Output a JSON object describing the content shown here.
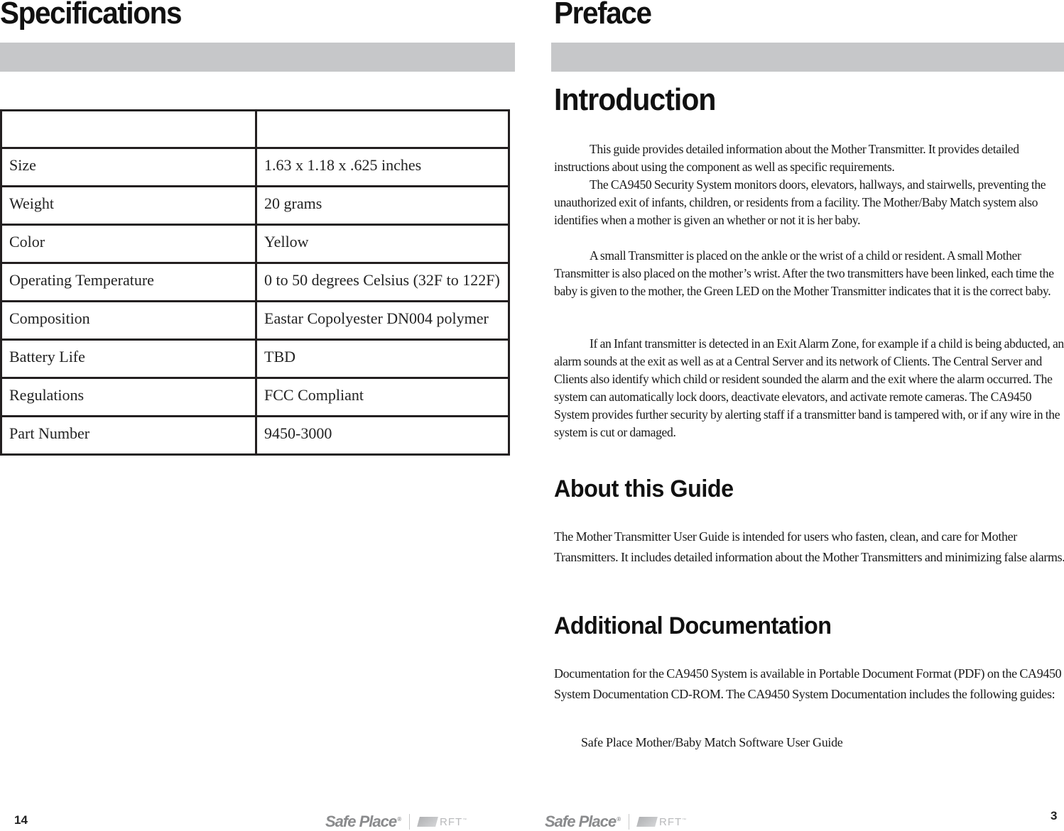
{
  "left_page": {
    "title": "Specifications",
    "table": {
      "header": [
        "",
        ""
      ],
      "rows": [
        {
          "label": "Size",
          "value": "1.63 x 1.18 x .625 inches"
        },
        {
          "label": "Weight",
          "value": "20 grams"
        },
        {
          "label": "Color",
          "value": "Yellow"
        },
        {
          "label": "Operating Temperature",
          "value": "0 to 50 degrees Celsius (32F to 122F)"
        },
        {
          "label": "Composition",
          "value": "Eastar Copolyester DN004 polymer"
        },
        {
          "label": "Battery Life",
          "value": "TBD"
        },
        {
          "label": "Regulations",
          "value": "FCC Compliant"
        },
        {
          "label": "Part Number",
          "value": "9450-3000"
        }
      ]
    },
    "page_number": "14",
    "logo": {
      "brand": "Safe Place",
      "partner": "RFT"
    }
  },
  "right_page": {
    "title": "Preface",
    "introduction": {
      "heading": "Introduction",
      "paragraphs": [
        "This guide provides detailed information about the Mother Transmitter. It provides detailed instructions about using the component as well as specific requirements.",
        "The CA9450 Security System monitors doors, elevators, hallways, and stairwells, preventing the unauthorized exit of infants, children, or residents from a facility. The Mother/Baby Match system also identifies when a mother is given an whether or not it is her baby.",
        "A small Transmitter is placed on the ankle or the wrist of a child or resident. A small Mother Transmitter is also placed on the mother’s wrist. After the two transmitters have been linked, each time the baby is given to the mother, the Green LED on the Mother Transmitter indicates that it is the correct baby.",
        "If an Infant  transmitter is detected in an Exit Alarm Zone, for example if a child is being abducted, an alarm sounds at the exit as well as at a Central Server and its network of Clients. The Central Server and Clients also identify which child or resident sounded the alarm and the exit where the alarm occurred. The system can automatically lock doors, deactivate elevators, and activate remote cameras. The CA9450 System provides further security by alerting staff if a transmitter band is tampered with, or if any wire in the system is cut or damaged."
      ]
    },
    "about": {
      "heading": "About this Guide",
      "paragraph": "The Mother Transmitter User Guide is intended for users who fasten, clean, and care for Mother Transmitters. It includes detailed information about the Mother Transmitters and minimizing false alarms."
    },
    "additional": {
      "heading": "Additional  Documentation",
      "paragraph": "Documentation for the CA9450 System is available in Portable Document Format (PDF) on the CA9450 System Documentation CD-ROM. The CA9450 System Documentation includes the following guides:",
      "guides": [
        "Safe Place Mother/Baby Match Software User Guide"
      ]
    },
    "page_number": "3",
    "logo": {
      "brand": "Safe Place",
      "partner": "RFT"
    }
  }
}
